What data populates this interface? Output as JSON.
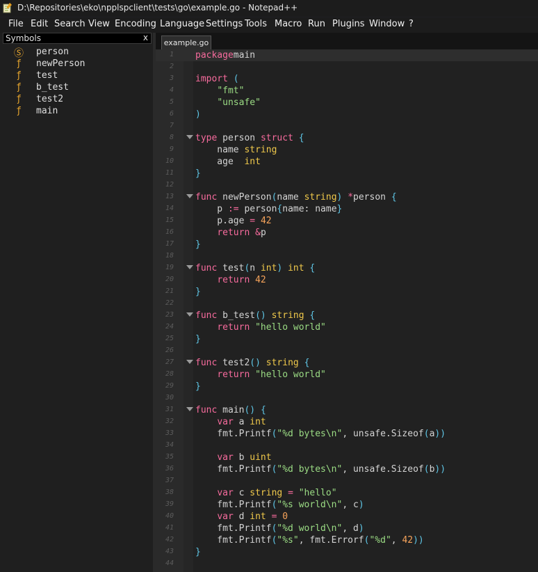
{
  "window": {
    "title": "D:\\Repositories\\eko\\npplspclient\\tests\\go\\example.go - Notepad++"
  },
  "menu": [
    "File",
    "Edit",
    "Search",
    "View",
    "Encoding",
    "Language",
    "Settings",
    "Tools",
    "Macro",
    "Run",
    "Plugins",
    "Window",
    "?"
  ],
  "symbols_panel": {
    "title": "Symbols",
    "close": "x",
    "items": [
      {
        "icon": "Ⓢ",
        "label": "person",
        "kind": "struct"
      },
      {
        "icon": "ƒ",
        "label": "newPerson",
        "kind": "function"
      },
      {
        "icon": "ƒ",
        "label": "test",
        "kind": "function"
      },
      {
        "icon": "ƒ",
        "label": "b_test",
        "kind": "function"
      },
      {
        "icon": "ƒ",
        "label": "test2",
        "kind": "function"
      },
      {
        "icon": "ƒ",
        "label": "main",
        "kind": "function"
      }
    ]
  },
  "editor": {
    "tab": "example.go",
    "current_line": 1,
    "lines": [
      {
        "n": "1",
        "fold": false,
        "tokens": [
          [
            "kw",
            "package"
          ],
          [
            "",
            "main"
          ]
        ]
      },
      {
        "n": "2",
        "fold": false,
        "tokens": []
      },
      {
        "n": "3",
        "fold": false,
        "tokens": [
          [
            "kw",
            "import"
          ],
          [
            "",
            " "
          ],
          [
            "pn",
            "("
          ]
        ]
      },
      {
        "n": "4",
        "fold": false,
        "tokens": [
          [
            "",
            "    "
          ],
          [
            "str",
            "\"fmt\""
          ]
        ]
      },
      {
        "n": "5",
        "fold": false,
        "tokens": [
          [
            "",
            "    "
          ],
          [
            "str",
            "\"unsafe\""
          ]
        ]
      },
      {
        "n": "6",
        "fold": false,
        "tokens": [
          [
            "pn",
            ")"
          ]
        ]
      },
      {
        "n": "7",
        "fold": false,
        "tokens": []
      },
      {
        "n": "8",
        "fold": true,
        "tokens": [
          [
            "kw",
            "type"
          ],
          [
            "",
            " person "
          ],
          [
            "kw",
            "struct"
          ],
          [
            "",
            " "
          ],
          [
            "pn",
            "{"
          ]
        ]
      },
      {
        "n": "9",
        "fold": false,
        "tokens": [
          [
            "",
            "    name "
          ],
          [
            "ty",
            "string"
          ]
        ]
      },
      {
        "n": "10",
        "fold": false,
        "tokens": [
          [
            "",
            "    age  "
          ],
          [
            "ty",
            "int"
          ]
        ]
      },
      {
        "n": "11",
        "fold": false,
        "tokens": [
          [
            "pn",
            "}"
          ]
        ]
      },
      {
        "n": "12",
        "fold": false,
        "tokens": []
      },
      {
        "n": "13",
        "fold": true,
        "tokens": [
          [
            "kw",
            "func"
          ],
          [
            "",
            " newPerson"
          ],
          [
            "pn",
            "("
          ],
          [
            "",
            "name "
          ],
          [
            "ty",
            "string"
          ],
          [
            "pn",
            ")"
          ],
          [
            "",
            " "
          ],
          [
            "kw",
            "*"
          ],
          [
            "",
            "person "
          ],
          [
            "pn",
            "{"
          ]
        ]
      },
      {
        "n": "14",
        "fold": false,
        "tokens": [
          [
            "",
            "    p "
          ],
          [
            "kw",
            ":="
          ],
          [
            "",
            " person"
          ],
          [
            "pn",
            "{"
          ],
          [
            "",
            "name: name"
          ],
          [
            "pn",
            "}"
          ]
        ]
      },
      {
        "n": "15",
        "fold": false,
        "tokens": [
          [
            "",
            "    p.age "
          ],
          [
            "kw",
            "="
          ],
          [
            "",
            " "
          ],
          [
            "num",
            "42"
          ]
        ]
      },
      {
        "n": "16",
        "fold": false,
        "tokens": [
          [
            "",
            "    "
          ],
          [
            "kw",
            "return"
          ],
          [
            "",
            " "
          ],
          [
            "kw",
            "&"
          ],
          [
            "",
            "p"
          ]
        ]
      },
      {
        "n": "17",
        "fold": false,
        "tokens": [
          [
            "pn",
            "}"
          ]
        ]
      },
      {
        "n": "18",
        "fold": false,
        "tokens": []
      },
      {
        "n": "19",
        "fold": true,
        "tokens": [
          [
            "kw",
            "func"
          ],
          [
            "",
            " test"
          ],
          [
            "pn",
            "("
          ],
          [
            "",
            "n "
          ],
          [
            "ty",
            "int"
          ],
          [
            "pn",
            ")"
          ],
          [
            "",
            " "
          ],
          [
            "ty",
            "int"
          ],
          [
            "",
            " "
          ],
          [
            "pn",
            "{"
          ]
        ]
      },
      {
        "n": "20",
        "fold": false,
        "tokens": [
          [
            "",
            "    "
          ],
          [
            "kw",
            "return"
          ],
          [
            "",
            " "
          ],
          [
            "num",
            "42"
          ]
        ]
      },
      {
        "n": "21",
        "fold": false,
        "tokens": [
          [
            "pn",
            "}"
          ]
        ]
      },
      {
        "n": "22",
        "fold": false,
        "tokens": []
      },
      {
        "n": "23",
        "fold": true,
        "tokens": [
          [
            "kw",
            "func"
          ],
          [
            "",
            " b_test"
          ],
          [
            "pn",
            "()"
          ],
          [
            "",
            " "
          ],
          [
            "ty",
            "string"
          ],
          [
            "",
            " "
          ],
          [
            "pn",
            "{"
          ]
        ]
      },
      {
        "n": "24",
        "fold": false,
        "tokens": [
          [
            "",
            "    "
          ],
          [
            "kw",
            "return"
          ],
          [
            "",
            " "
          ],
          [
            "str",
            "\"hello world\""
          ]
        ]
      },
      {
        "n": "25",
        "fold": false,
        "tokens": [
          [
            "pn",
            "}"
          ]
        ]
      },
      {
        "n": "26",
        "fold": false,
        "tokens": []
      },
      {
        "n": "27",
        "fold": true,
        "tokens": [
          [
            "kw",
            "func"
          ],
          [
            "",
            " test2"
          ],
          [
            "pn",
            "()"
          ],
          [
            "",
            " "
          ],
          [
            "ty",
            "string"
          ],
          [
            "",
            " "
          ],
          [
            "pn",
            "{"
          ]
        ]
      },
      {
        "n": "28",
        "fold": false,
        "tokens": [
          [
            "",
            "    "
          ],
          [
            "kw",
            "return"
          ],
          [
            "",
            " "
          ],
          [
            "str",
            "\"hello world\""
          ]
        ]
      },
      {
        "n": "29",
        "fold": false,
        "tokens": [
          [
            "pn",
            "}"
          ]
        ]
      },
      {
        "n": "30",
        "fold": false,
        "tokens": []
      },
      {
        "n": "31",
        "fold": true,
        "tokens": [
          [
            "kw",
            "func"
          ],
          [
            "",
            " main"
          ],
          [
            "pn",
            "()"
          ],
          [
            "",
            " "
          ],
          [
            "pn",
            "{"
          ]
        ]
      },
      {
        "n": "32",
        "fold": false,
        "tokens": [
          [
            "",
            "    "
          ],
          [
            "kw",
            "var"
          ],
          [
            "",
            " a "
          ],
          [
            "ty",
            "int"
          ]
        ]
      },
      {
        "n": "33",
        "fold": false,
        "tokens": [
          [
            "",
            "    fmt.Printf"
          ],
          [
            "pn",
            "("
          ],
          [
            "str",
            "\"%d bytes\\n\""
          ],
          [
            "",
            ", unsafe.Sizeof"
          ],
          [
            "pn",
            "("
          ],
          [
            "",
            "a"
          ],
          [
            "pn",
            "))"
          ]
        ]
      },
      {
        "n": "34",
        "fold": false,
        "tokens": []
      },
      {
        "n": "35",
        "fold": false,
        "tokens": [
          [
            "",
            "    "
          ],
          [
            "kw",
            "var"
          ],
          [
            "",
            " b "
          ],
          [
            "ty",
            "uint"
          ]
        ]
      },
      {
        "n": "36",
        "fold": false,
        "tokens": [
          [
            "",
            "    fmt.Printf"
          ],
          [
            "pn",
            "("
          ],
          [
            "str",
            "\"%d bytes\\n\""
          ],
          [
            "",
            ", unsafe.Sizeof"
          ],
          [
            "pn",
            "("
          ],
          [
            "",
            "b"
          ],
          [
            "pn",
            "))"
          ]
        ]
      },
      {
        "n": "37",
        "fold": false,
        "tokens": []
      },
      {
        "n": "38",
        "fold": false,
        "tokens": [
          [
            "",
            "    "
          ],
          [
            "kw",
            "var"
          ],
          [
            "",
            " c "
          ],
          [
            "ty",
            "string"
          ],
          [
            "",
            " "
          ],
          [
            "kw",
            "="
          ],
          [
            "",
            " "
          ],
          [
            "str",
            "\"hello\""
          ]
        ]
      },
      {
        "n": "39",
        "fold": false,
        "tokens": [
          [
            "",
            "    fmt.Printf"
          ],
          [
            "pn",
            "("
          ],
          [
            "str",
            "\"%s world\\n\""
          ],
          [
            "",
            ", c"
          ],
          [
            "pn",
            ")"
          ]
        ]
      },
      {
        "n": "40",
        "fold": false,
        "tokens": [
          [
            "",
            "    "
          ],
          [
            "kw",
            "var"
          ],
          [
            "",
            " d "
          ],
          [
            "ty",
            "int"
          ],
          [
            "",
            " "
          ],
          [
            "kw",
            "="
          ],
          [
            "",
            " "
          ],
          [
            "num",
            "0"
          ]
        ]
      },
      {
        "n": "41",
        "fold": false,
        "tokens": [
          [
            "",
            "    fmt.Printf"
          ],
          [
            "pn",
            "("
          ],
          [
            "str",
            "\"%d world\\n\""
          ],
          [
            "",
            ", d"
          ],
          [
            "pn",
            ")"
          ]
        ]
      },
      {
        "n": "42",
        "fold": false,
        "tokens": [
          [
            "",
            "    fmt.Printf"
          ],
          [
            "pn",
            "("
          ],
          [
            "str",
            "\"%s\""
          ],
          [
            "",
            ", fmt.Errorf"
          ],
          [
            "pn",
            "("
          ],
          [
            "str",
            "\"%d\""
          ],
          [
            "",
            ", "
          ],
          [
            "num",
            "42"
          ],
          [
            "pn",
            "))"
          ]
        ]
      },
      {
        "n": "43",
        "fold": false,
        "tokens": [
          [
            "pn",
            "}"
          ]
        ]
      },
      {
        "n": "44",
        "fold": false,
        "tokens": []
      }
    ]
  }
}
